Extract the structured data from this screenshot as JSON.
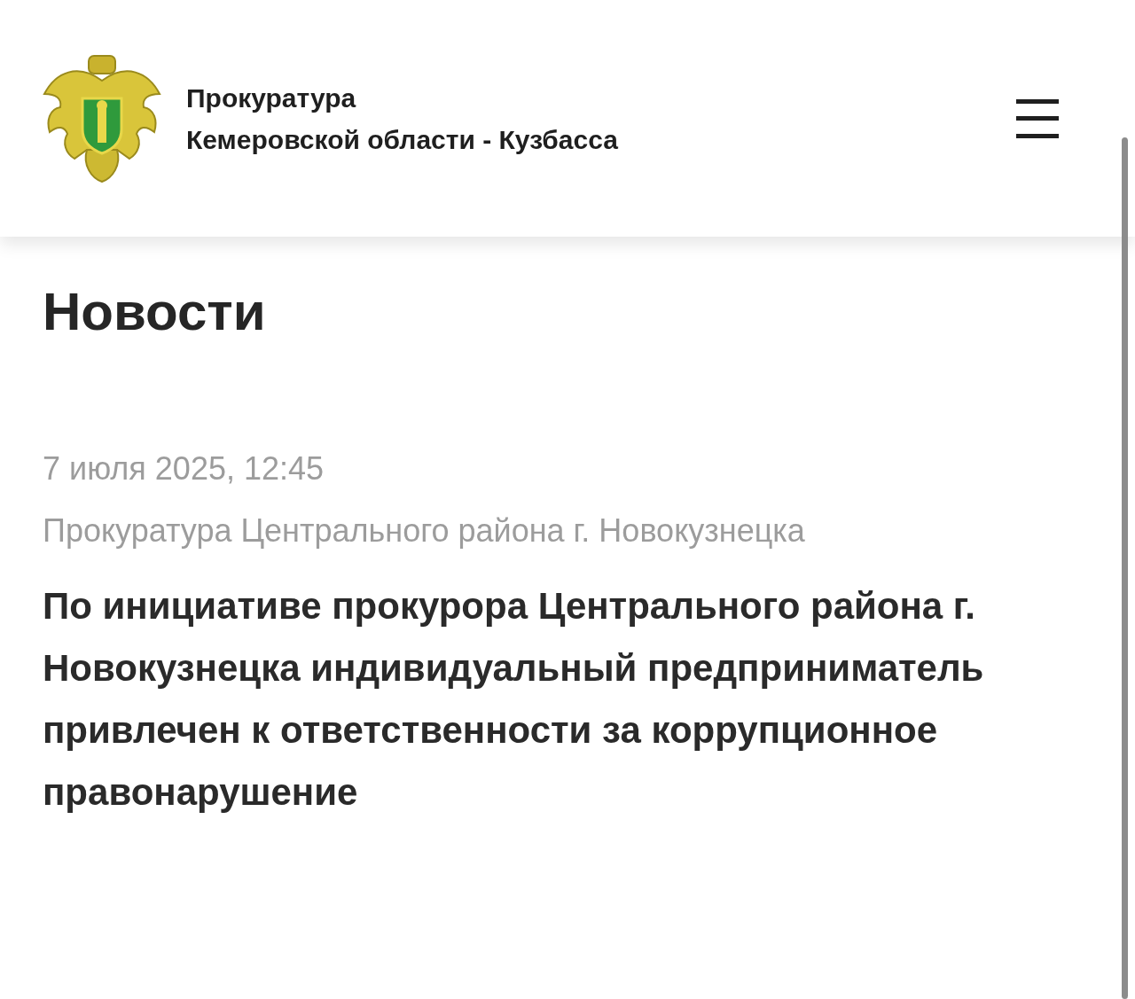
{
  "header": {
    "title_lines": [
      "Прокуратура",
      "Кемеровской области - Кузбасса"
    ]
  },
  "page_title": "Новости",
  "news": [
    {
      "date": "7 июля 2025, 12:45",
      "source": "Прокуратура Центрального района г. Новокузнецка",
      "headline": "По инициативе прокурора Центрального района г. Новокузнецка индивидуальный предприниматель привлечен к ответственности за коррупционное правонарушение"
    }
  ]
}
